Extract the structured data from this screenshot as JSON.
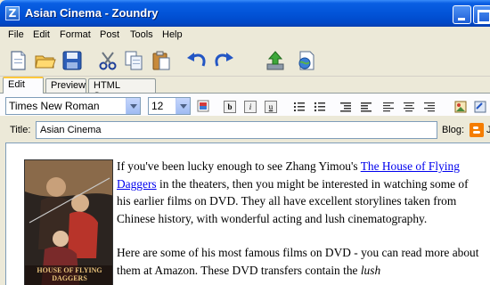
{
  "window": {
    "title": "Asian Cinema - Zoundry",
    "app_icon_letter": "Z"
  },
  "menu": [
    "File",
    "Edit",
    "Format",
    "Post",
    "Tools",
    "Help"
  ],
  "toolbar": {
    "icons": [
      "new-post-icon",
      "open-folder-icon",
      "save-icon",
      "cut-icon",
      "copy-icon",
      "paste-icon",
      "undo-icon",
      "redo-icon",
      "publish-icon",
      "preview-web-icon"
    ]
  },
  "tabs": [
    "Edit",
    "Preview",
    "HTML Source"
  ],
  "format": {
    "font_family": "Times New Roman",
    "font_size": "12",
    "bold": "b",
    "italic": "i",
    "underline": "u"
  },
  "post": {
    "title_label": "Title:",
    "title_value": "Asian Cinema",
    "blog_label": "Blog:",
    "blog_initial": "J"
  },
  "article": {
    "poster_caption": "HOUSE OF FLYING DAGGERS",
    "p1_before": "If you've been lucky enough to see Zhang Yimou's ",
    "p1_link": "The House of Flying Daggers",
    "p1_after": " in the theaters, then you might be interested in watching some of his earlier films on DVD.  They all have excellent storylines taken from Chinese history, with wonderful acting and lush cinematography.",
    "p2_text": "Here are some of his most famous films on DVD - you can read more about them at Amazon.  These DVD transfers contain the ",
    "p2_italic": "lush"
  },
  "colors": {
    "titlebar": "#0254d8",
    "link": "#0000ee",
    "active_tab_accent": "#ffc83c",
    "blogger_orange": "#f57d00"
  }
}
